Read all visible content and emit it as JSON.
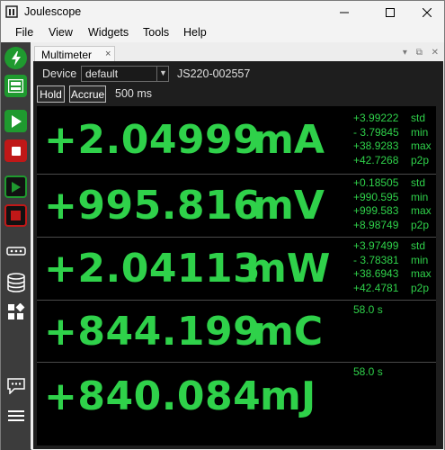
{
  "window": {
    "title": "Joulescope",
    "controls": [
      "minimize",
      "maximize",
      "close"
    ]
  },
  "menubar": [
    "File",
    "View",
    "Widgets",
    "Tools",
    "Help"
  ],
  "sidebar": {
    "icons": [
      "power-icon",
      "multimeter-icon",
      "play-icon",
      "stop-icon",
      "record-play-icon",
      "record-stop-icon",
      "serial-icon",
      "storage-icon",
      "widgets-icon",
      "chat-icon",
      "menu-icon"
    ]
  },
  "tab": {
    "label": "Multimeter",
    "close": "×"
  },
  "multimeter": {
    "device_label": "Device",
    "device_value": "default",
    "serial": "JS220-002557",
    "hold_label": "Hold",
    "accrue_label": "Accrue",
    "interval": "500 ms",
    "rows": [
      {
        "value": "+2.04999",
        "unit": "mA",
        "stats": [
          {
            "value": "+3.99222",
            "label": "std"
          },
          {
            "value": "- 3.79845",
            "label": "min"
          },
          {
            "value": "+38.9283",
            "label": "max"
          },
          {
            "value": "+42.7268",
            "label": "p2p"
          }
        ]
      },
      {
        "value": "+995.816",
        "unit": "mV",
        "stats": [
          {
            "value": "+0.18505",
            "label": "std"
          },
          {
            "value": "+990.595",
            "label": "min"
          },
          {
            "value": "+999.583",
            "label": "max"
          },
          {
            "value": "+8.98749",
            "label": "p2p"
          }
        ]
      },
      {
        "value": "+2.04113",
        "unit": "mW",
        "stats": [
          {
            "value": "+3.97499",
            "label": "std"
          },
          {
            "value": "- 3.78381",
            "label": "min"
          },
          {
            "value": "+38.6943",
            "label": "max"
          },
          {
            "value": "+42.4781",
            "label": "p2p"
          }
        ]
      },
      {
        "value": "+844.199",
        "unit": "mC",
        "accrue_time": "58.0 s"
      },
      {
        "value": "+840.084",
        "unit": "mJ",
        "accrue_time": "58.0 s"
      }
    ]
  },
  "colors": {
    "readout": "#2fd14a",
    "sidebar_bg": "#3c3c3c",
    "sidebar_green": "#1f9a2f",
    "sidebar_red": "#c01818"
  }
}
